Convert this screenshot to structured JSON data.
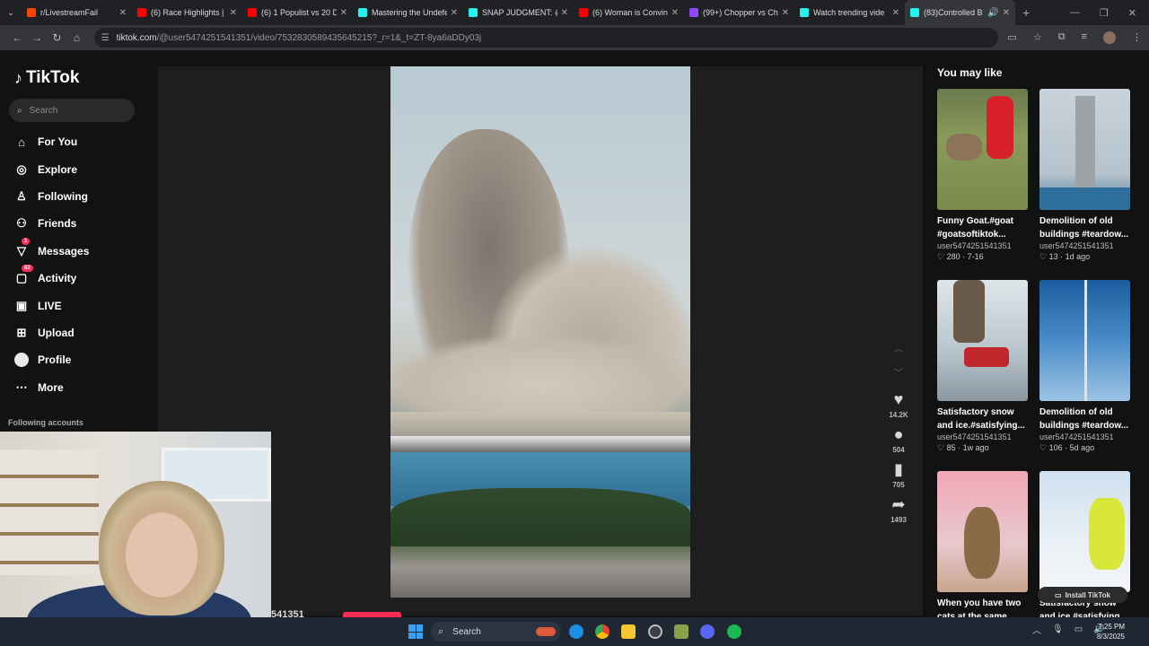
{
  "browser": {
    "tabs": [
      {
        "title": "r/LivestreamFail",
        "color": "#ff4500"
      },
      {
        "title": "(6) Race Highlights | ",
        "color": "#ff0000"
      },
      {
        "title": "(6) 1 Populist vs 20 D",
        "color": "#ff0000"
      },
      {
        "title": "Mastering the Undefe",
        "color": "#25f4ee"
      },
      {
        "title": "SNAP JUDGMENT: @",
        "color": "#25f4ee"
      },
      {
        "title": "(6) Woman is Convin",
        "color": "#ff0000"
      },
      {
        "title": "(99+) Chopper vs Ch",
        "color": "#9146ff"
      },
      {
        "title": "Watch trending vide",
        "color": "#25f4ee"
      },
      {
        "title": "(83)Controlled B",
        "color": "#25f4ee"
      }
    ],
    "url_host": "tiktok.com",
    "url_path": "/@user5474251541351/video/7532830589435645215?_r=1&_t=ZT-8ya6aDDy03j"
  },
  "sidebar": {
    "logo": "TikTok",
    "search_placeholder": "Search",
    "items": [
      {
        "label": "For You",
        "icon": "home-icon"
      },
      {
        "label": "Explore",
        "icon": "compass-icon"
      },
      {
        "label": "Following",
        "icon": "following-icon"
      },
      {
        "label": "Friends",
        "icon": "friends-icon"
      },
      {
        "label": "Messages",
        "icon": "messages-icon",
        "badge": "1"
      },
      {
        "label": "Activity",
        "icon": "activity-icon",
        "badge": "82"
      },
      {
        "label": "LIVE",
        "icon": "live-icon"
      },
      {
        "label": "Upload",
        "icon": "upload-icon"
      },
      {
        "label": "Profile",
        "icon": "profile-icon"
      },
      {
        "label": "More",
        "icon": "more-icon"
      }
    ],
    "following_accounts": "Following accounts"
  },
  "video": {
    "likes": "14.2K",
    "comments": "504",
    "saves": "705",
    "shares": "1493",
    "author_partial": "541351"
  },
  "recommendations": {
    "heading": "You may like",
    "cards": [
      {
        "title": "Funny Goat.#goat #goatsoftiktok...",
        "user": "user5474251541351",
        "likes": "280",
        "age": "7-16"
      },
      {
        "title": "Demolition of old buildings #teardow...",
        "user": "user5474251541351",
        "likes": "13",
        "age": "1d ago"
      },
      {
        "title": "Satisfactory snow and ice.#satisfying...",
        "user": "user5474251541351",
        "likes": "85",
        "age": "1w ago"
      },
      {
        "title": "Demolition of old buildings #teardow...",
        "user": "user5474251541351",
        "likes": "106",
        "age": "5d ago"
      },
      {
        "title": "When you have two cats at the same...",
        "user": "",
        "likes": "",
        "age": ""
      },
      {
        "title": "Satisfactory snow and ice.#satisfying...",
        "user": "",
        "likes": "",
        "age": ""
      }
    ],
    "install": "Install TikTok"
  },
  "taskbar": {
    "search": "Search",
    "time": "7:25 PM",
    "date": "8/3/2025"
  },
  "colors": {
    "accent": "#fe2c55",
    "background": "#121212"
  }
}
